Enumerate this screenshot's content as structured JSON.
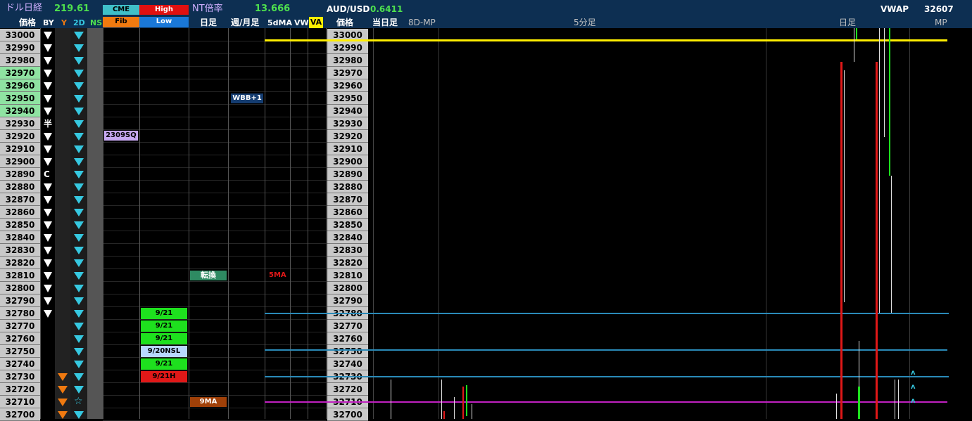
{
  "header": {
    "title": "ドル日経",
    "title_value": "219.61",
    "cme_label": "CME",
    "high_label": "High",
    "fib_label": "Fib",
    "low_label": "Low",
    "nt_label": "NT倍率",
    "nt_value": "13.666",
    "aud_label": "AUD/USD",
    "aud_value": "0.6411",
    "vwap_label": "VWAP",
    "vwap_value": "32607"
  },
  "columns": {
    "price": "価格",
    "by": "BY",
    "y": "Y",
    "two_d": "2D",
    "ns": "NS",
    "daily": "日足",
    "weekly_monthly": "週/月足",
    "five_dma": "5dMA",
    "vw": "VW",
    "va": "VA",
    "price2": "価格",
    "today_daily": "当日足",
    "eight_d_mp": "8D-MP",
    "five_min": "5分足",
    "daily2": "日足",
    "mp": "MP"
  },
  "prices": [
    "33000",
    "32990",
    "32980",
    "32970",
    "32960",
    "32950",
    "32940",
    "32930",
    "32920",
    "32910",
    "32900",
    "32890",
    "32880",
    "32870",
    "32860",
    "32850",
    "32840",
    "32830",
    "32820",
    "32810",
    "32800",
    "32790",
    "32780",
    "32770",
    "32760",
    "32750",
    "32740",
    "32730",
    "32720",
    "32710",
    "32700"
  ],
  "by_marks": {
    "32930": "半",
    "32890": "C"
  },
  "labels": {
    "wbb": "WBB+1",
    "sq": "2309SQ",
    "tenkan": "転換",
    "five_ma": "5MA",
    "nine_ma": "9MA",
    "low_9_21_a": "9/21",
    "low_9_21_b": "9/21",
    "low_9_21_c": "9/21",
    "low_9_20nsl": "9/20NSL",
    "low_9_21_d": "9/21",
    "low_9_21h": "9/21H"
  },
  "colors": {
    "header_bg": "#0d2f52",
    "green_price": "#8fe3a2",
    "yellow_line": "#ffee00",
    "blue_line": "#2a8ab8",
    "magenta_line": "#c020c0",
    "low_green": "#1ee01e",
    "high_red": "#e01818"
  }
}
